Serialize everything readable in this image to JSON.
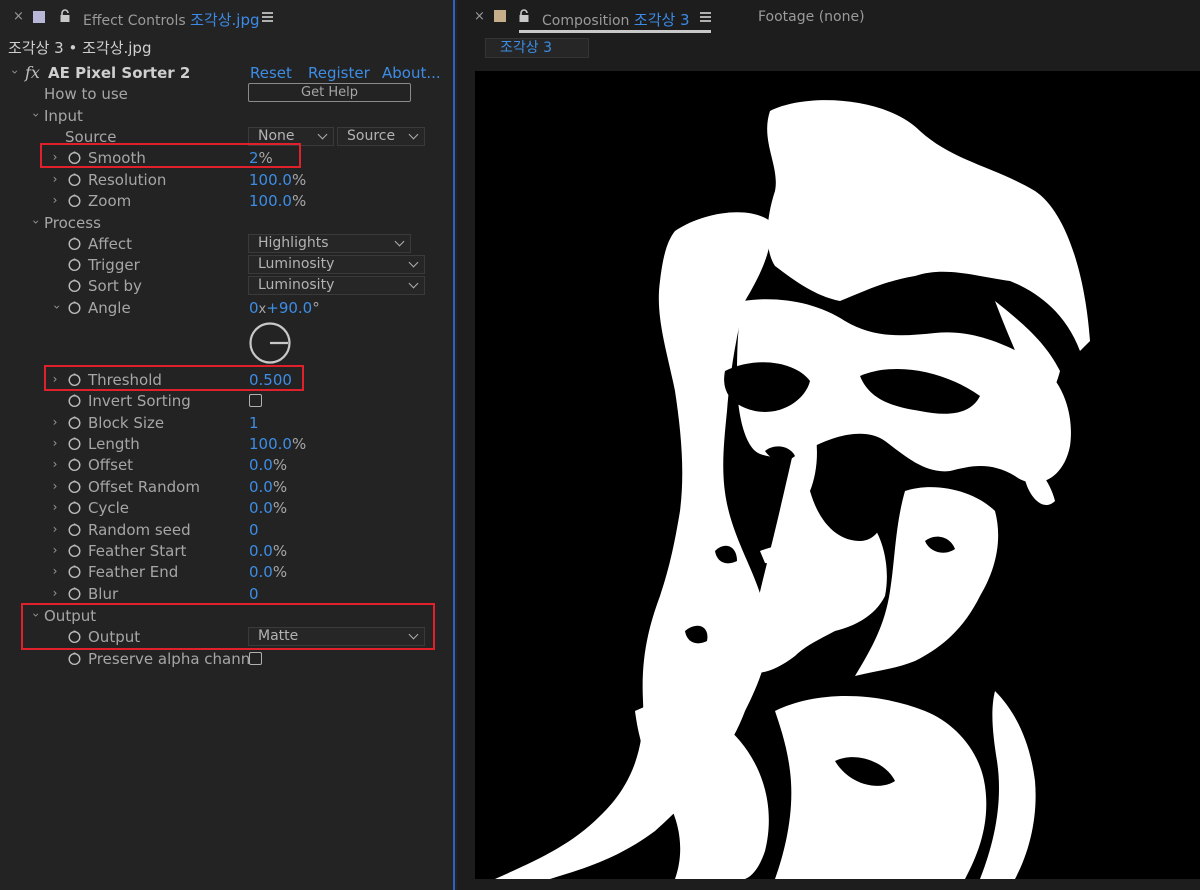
{
  "effect_controls": {
    "close": "×",
    "tab_prefix": "Effect Controls",
    "tab_file": "조각상.jpg",
    "layer_path": "조각상 3 • 조각상.jpg",
    "effect_name": "AE Pixel Sorter 2",
    "fx_mark": "fx",
    "links": {
      "reset": "Reset",
      "register": "Register",
      "about": "About..."
    },
    "how_to_use": "How to use",
    "get_help": "Get Help",
    "input": {
      "label": "Input",
      "source_label": "Source",
      "source_value": "None",
      "source_mode": "Source",
      "smooth": {
        "label": "Smooth",
        "value": "2",
        "unit": "%"
      },
      "resolution": {
        "label": "Resolution",
        "value": "100.0",
        "unit": "%"
      },
      "zoom": {
        "label": "Zoom",
        "value": "100.0",
        "unit": "%"
      }
    },
    "process": {
      "label": "Process",
      "affect": {
        "label": "Affect",
        "value": "Highlights"
      },
      "trigger": {
        "label": "Trigger",
        "value": "Luminosity"
      },
      "sort_by": {
        "label": "Sort by",
        "value": "Luminosity"
      },
      "angle": {
        "label": "Angle",
        "revolutions": "0",
        "x": "x",
        "degrees": "+90.0",
        "unit": "°"
      },
      "threshold": {
        "label": "Threshold",
        "value": "0.500"
      },
      "invert_sorting": {
        "label": "Invert Sorting",
        "checked": false
      },
      "block_size": {
        "label": "Block Size",
        "value": "1"
      },
      "length": {
        "label": "Length",
        "value": "100.0",
        "unit": "%"
      },
      "offset": {
        "label": "Offset",
        "value": "0.0",
        "unit": "%"
      },
      "offset_random": {
        "label": "Offset Random",
        "value": "0.0",
        "unit": "%"
      },
      "cycle": {
        "label": "Cycle",
        "value": "0.0",
        "unit": "%"
      },
      "random_seed": {
        "label": "Random seed",
        "value": "0"
      },
      "feather_start": {
        "label": "Feather Start",
        "value": "0.0",
        "unit": "%"
      },
      "feather_end": {
        "label": "Feather End",
        "value": "0.0",
        "unit": "%"
      },
      "blur": {
        "label": "Blur",
        "value": "0"
      }
    },
    "output": {
      "label": "Output",
      "output_param": {
        "label": "Output",
        "value": "Matte"
      },
      "preserve_alpha": {
        "label": "Preserve alpha chann",
        "checked": false
      }
    }
  },
  "composition": {
    "close": "×",
    "tab_prefix": "Composition",
    "tab_name": "조각상 3",
    "footage_tab": "Footage  (none)",
    "sub_tab": "조각상 3"
  },
  "colors": {
    "accent_blue": "#3d8de6",
    "highlight_red": "#e0202a",
    "panel_bg": "#232323"
  },
  "icons": {
    "close": "close-icon",
    "lock": "lock-icon",
    "menu": "hamburger-menu-icon",
    "stopwatch": "stopwatch-icon",
    "twirl": "chevron-right-icon"
  }
}
